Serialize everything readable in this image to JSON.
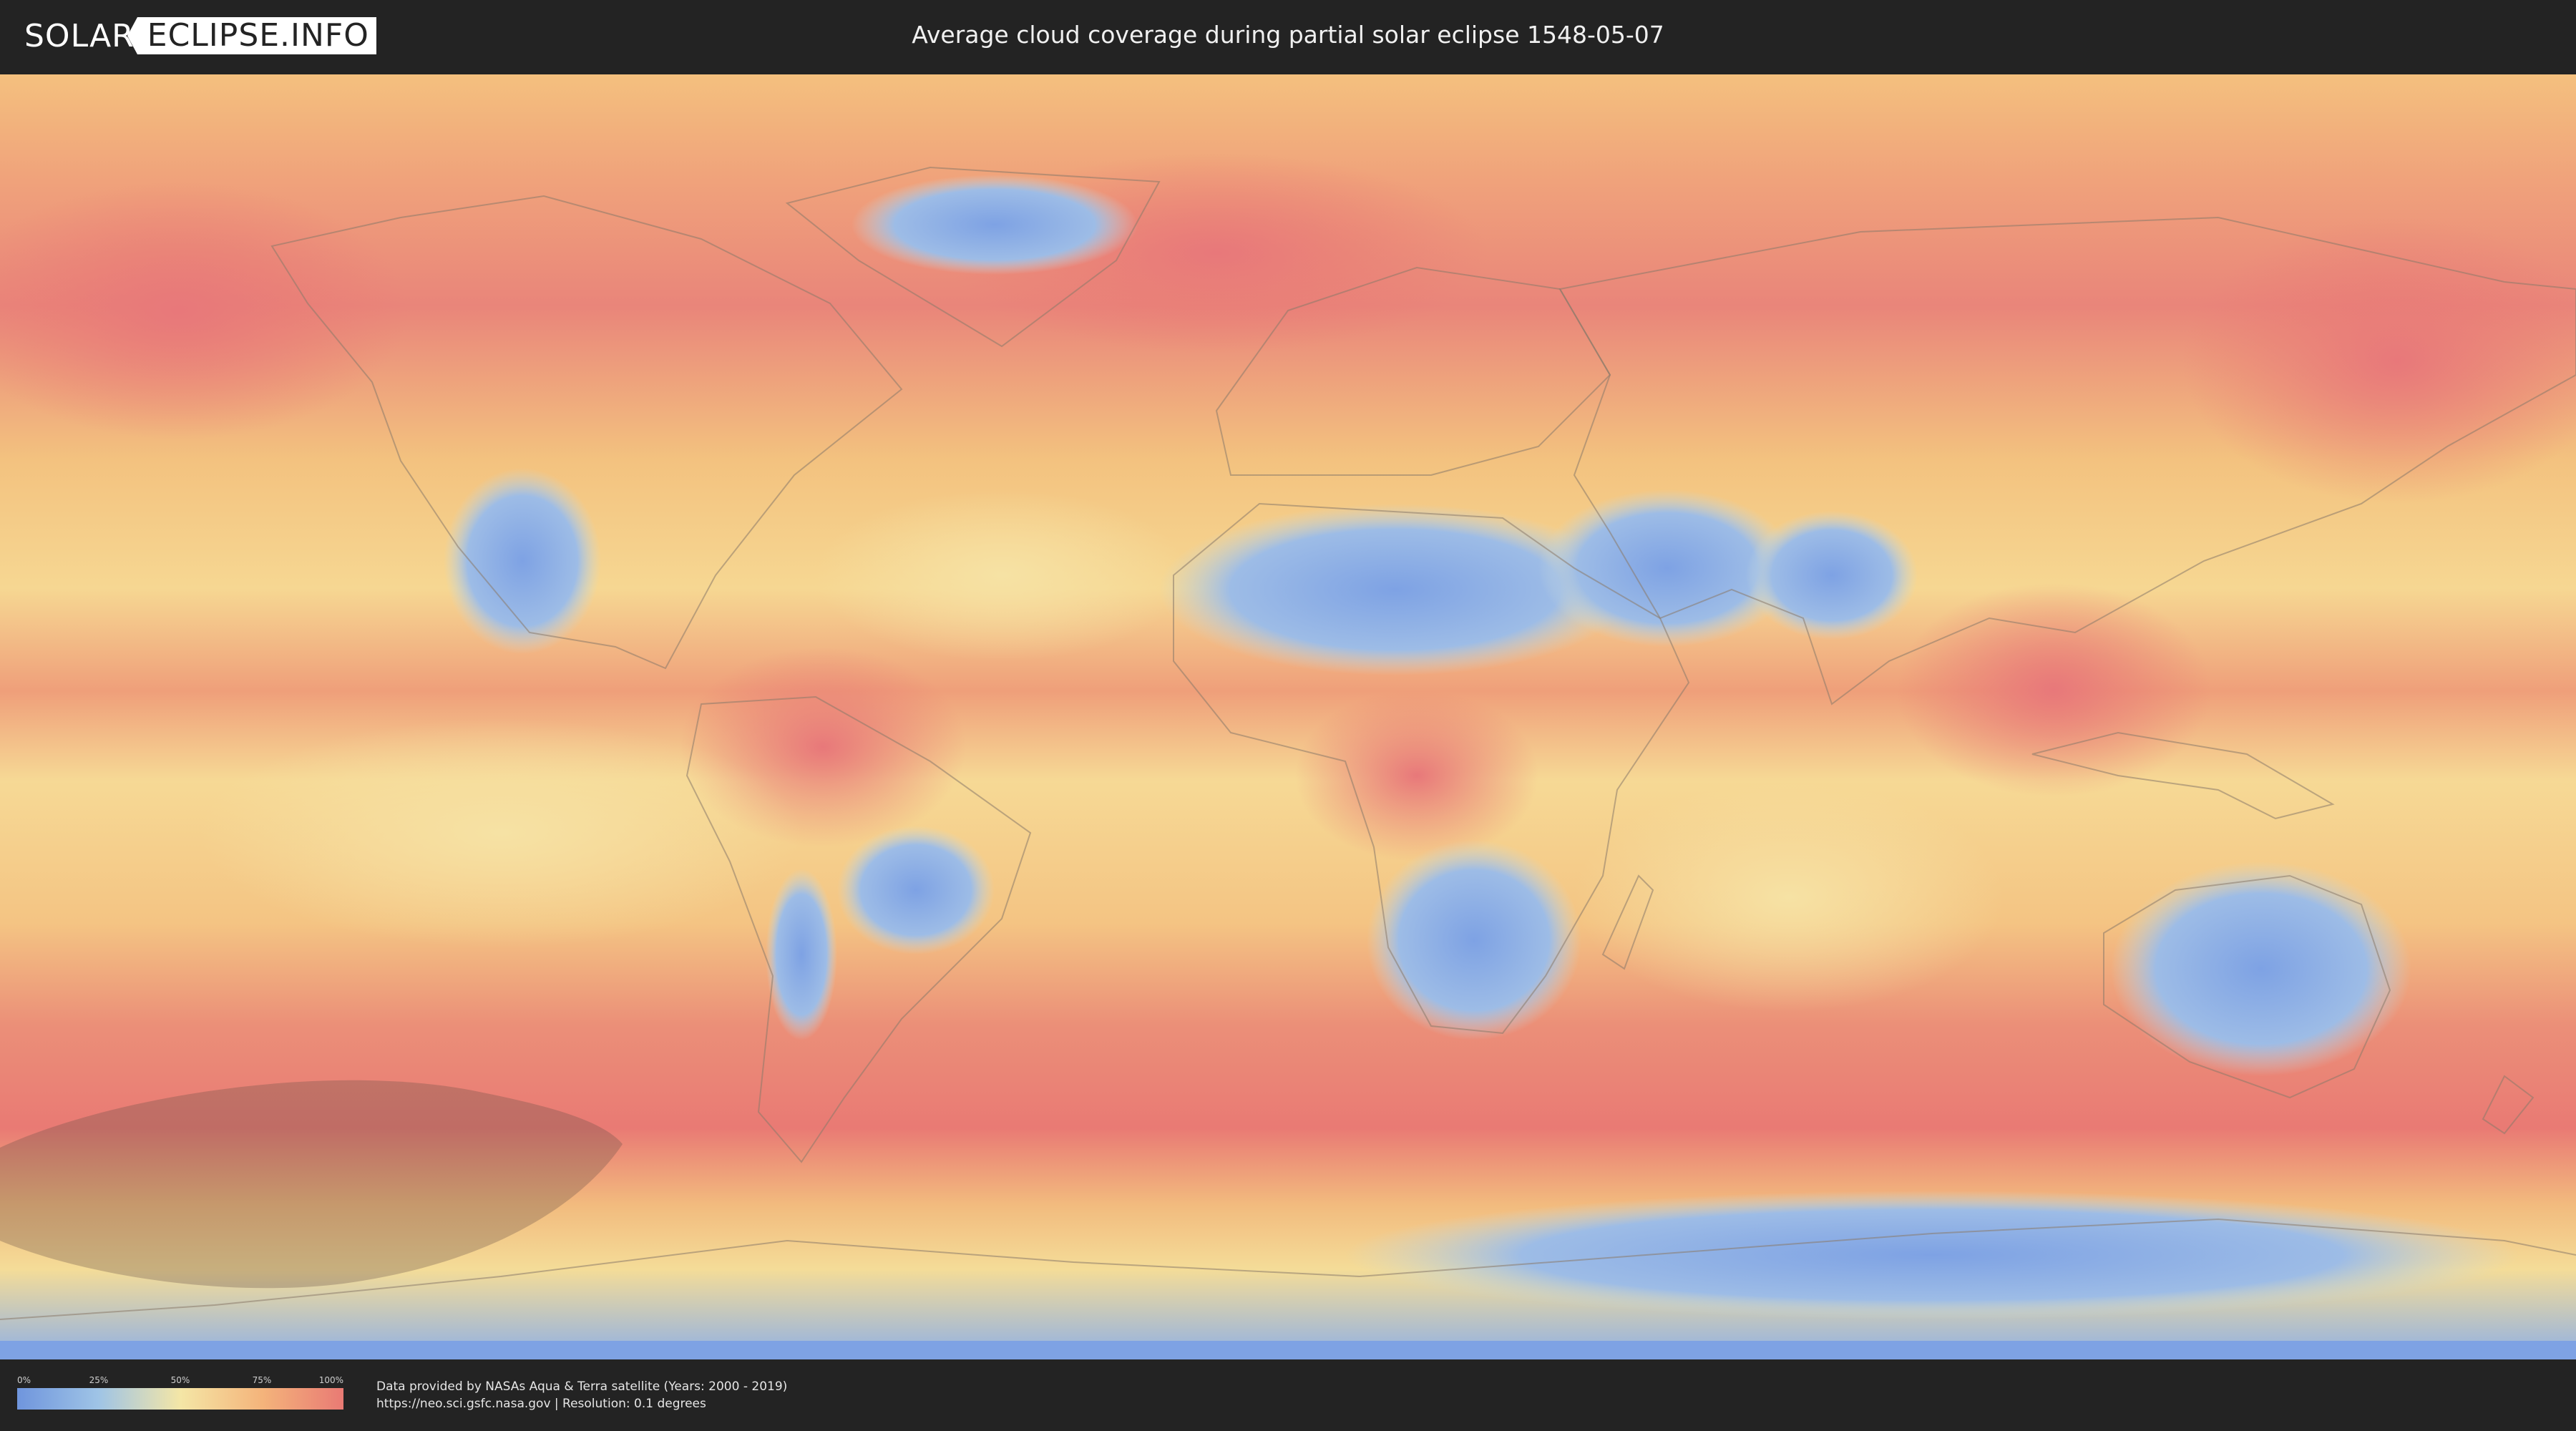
{
  "header": {
    "logo_left": "SOLAR",
    "logo_right": "ECLIPSE.INFO",
    "title": "Average cloud coverage during partial solar eclipse 1548-05-07"
  },
  "map": {
    "colors": {
      "low": "#6f95dd",
      "low_mid": "#9fc4e6",
      "mid": "#f4e6a6",
      "high_mid": "#f4b47b",
      "high": "#e97a74"
    },
    "overlay": "partial-eclipse-shadow-region"
  },
  "footer": {
    "legend_ticks": [
      "0%",
      "25%",
      "50%",
      "75%",
      "100%"
    ],
    "credit_line_1": "Data provided by NASAs Aqua & Terra satellite (Years: 2000 - 2019)",
    "credit_line_2": "https://neo.sci.gsfc.nasa.gov | Resolution: 0.1 degrees"
  }
}
